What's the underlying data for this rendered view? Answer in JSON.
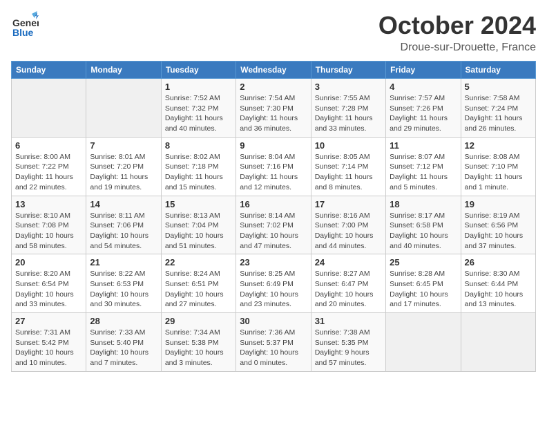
{
  "logo": {
    "general": "General",
    "blue": "Blue"
  },
  "title": "October 2024",
  "location": "Droue-sur-Drouette, France",
  "weekdays": [
    "Sunday",
    "Monday",
    "Tuesday",
    "Wednesday",
    "Thursday",
    "Friday",
    "Saturday"
  ],
  "weeks": [
    [
      {
        "day": "",
        "info": ""
      },
      {
        "day": "",
        "info": ""
      },
      {
        "day": "1",
        "info": "Sunrise: 7:52 AM\nSunset: 7:32 PM\nDaylight: 11 hours\nand 40 minutes."
      },
      {
        "day": "2",
        "info": "Sunrise: 7:54 AM\nSunset: 7:30 PM\nDaylight: 11 hours\nand 36 minutes."
      },
      {
        "day": "3",
        "info": "Sunrise: 7:55 AM\nSunset: 7:28 PM\nDaylight: 11 hours\nand 33 minutes."
      },
      {
        "day": "4",
        "info": "Sunrise: 7:57 AM\nSunset: 7:26 PM\nDaylight: 11 hours\nand 29 minutes."
      },
      {
        "day": "5",
        "info": "Sunrise: 7:58 AM\nSunset: 7:24 PM\nDaylight: 11 hours\nand 26 minutes."
      }
    ],
    [
      {
        "day": "6",
        "info": "Sunrise: 8:00 AM\nSunset: 7:22 PM\nDaylight: 11 hours\nand 22 minutes."
      },
      {
        "day": "7",
        "info": "Sunrise: 8:01 AM\nSunset: 7:20 PM\nDaylight: 11 hours\nand 19 minutes."
      },
      {
        "day": "8",
        "info": "Sunrise: 8:02 AM\nSunset: 7:18 PM\nDaylight: 11 hours\nand 15 minutes."
      },
      {
        "day": "9",
        "info": "Sunrise: 8:04 AM\nSunset: 7:16 PM\nDaylight: 11 hours\nand 12 minutes."
      },
      {
        "day": "10",
        "info": "Sunrise: 8:05 AM\nSunset: 7:14 PM\nDaylight: 11 hours\nand 8 minutes."
      },
      {
        "day": "11",
        "info": "Sunrise: 8:07 AM\nSunset: 7:12 PM\nDaylight: 11 hours\nand 5 minutes."
      },
      {
        "day": "12",
        "info": "Sunrise: 8:08 AM\nSunset: 7:10 PM\nDaylight: 11 hours\nand 1 minute."
      }
    ],
    [
      {
        "day": "13",
        "info": "Sunrise: 8:10 AM\nSunset: 7:08 PM\nDaylight: 10 hours\nand 58 minutes."
      },
      {
        "day": "14",
        "info": "Sunrise: 8:11 AM\nSunset: 7:06 PM\nDaylight: 10 hours\nand 54 minutes."
      },
      {
        "day": "15",
        "info": "Sunrise: 8:13 AM\nSunset: 7:04 PM\nDaylight: 10 hours\nand 51 minutes."
      },
      {
        "day": "16",
        "info": "Sunrise: 8:14 AM\nSunset: 7:02 PM\nDaylight: 10 hours\nand 47 minutes."
      },
      {
        "day": "17",
        "info": "Sunrise: 8:16 AM\nSunset: 7:00 PM\nDaylight: 10 hours\nand 44 minutes."
      },
      {
        "day": "18",
        "info": "Sunrise: 8:17 AM\nSunset: 6:58 PM\nDaylight: 10 hours\nand 40 minutes."
      },
      {
        "day": "19",
        "info": "Sunrise: 8:19 AM\nSunset: 6:56 PM\nDaylight: 10 hours\nand 37 minutes."
      }
    ],
    [
      {
        "day": "20",
        "info": "Sunrise: 8:20 AM\nSunset: 6:54 PM\nDaylight: 10 hours\nand 33 minutes."
      },
      {
        "day": "21",
        "info": "Sunrise: 8:22 AM\nSunset: 6:53 PM\nDaylight: 10 hours\nand 30 minutes."
      },
      {
        "day": "22",
        "info": "Sunrise: 8:24 AM\nSunset: 6:51 PM\nDaylight: 10 hours\nand 27 minutes."
      },
      {
        "day": "23",
        "info": "Sunrise: 8:25 AM\nSunset: 6:49 PM\nDaylight: 10 hours\nand 23 minutes."
      },
      {
        "day": "24",
        "info": "Sunrise: 8:27 AM\nSunset: 6:47 PM\nDaylight: 10 hours\nand 20 minutes."
      },
      {
        "day": "25",
        "info": "Sunrise: 8:28 AM\nSunset: 6:45 PM\nDaylight: 10 hours\nand 17 minutes."
      },
      {
        "day": "26",
        "info": "Sunrise: 8:30 AM\nSunset: 6:44 PM\nDaylight: 10 hours\nand 13 minutes."
      }
    ],
    [
      {
        "day": "27",
        "info": "Sunrise: 7:31 AM\nSunset: 5:42 PM\nDaylight: 10 hours\nand 10 minutes."
      },
      {
        "day": "28",
        "info": "Sunrise: 7:33 AM\nSunset: 5:40 PM\nDaylight: 10 hours\nand 7 minutes."
      },
      {
        "day": "29",
        "info": "Sunrise: 7:34 AM\nSunset: 5:38 PM\nDaylight: 10 hours\nand 3 minutes."
      },
      {
        "day": "30",
        "info": "Sunrise: 7:36 AM\nSunset: 5:37 PM\nDaylight: 10 hours\nand 0 minutes."
      },
      {
        "day": "31",
        "info": "Sunrise: 7:38 AM\nSunset: 5:35 PM\nDaylight: 9 hours\nand 57 minutes."
      },
      {
        "day": "",
        "info": ""
      },
      {
        "day": "",
        "info": ""
      }
    ]
  ]
}
